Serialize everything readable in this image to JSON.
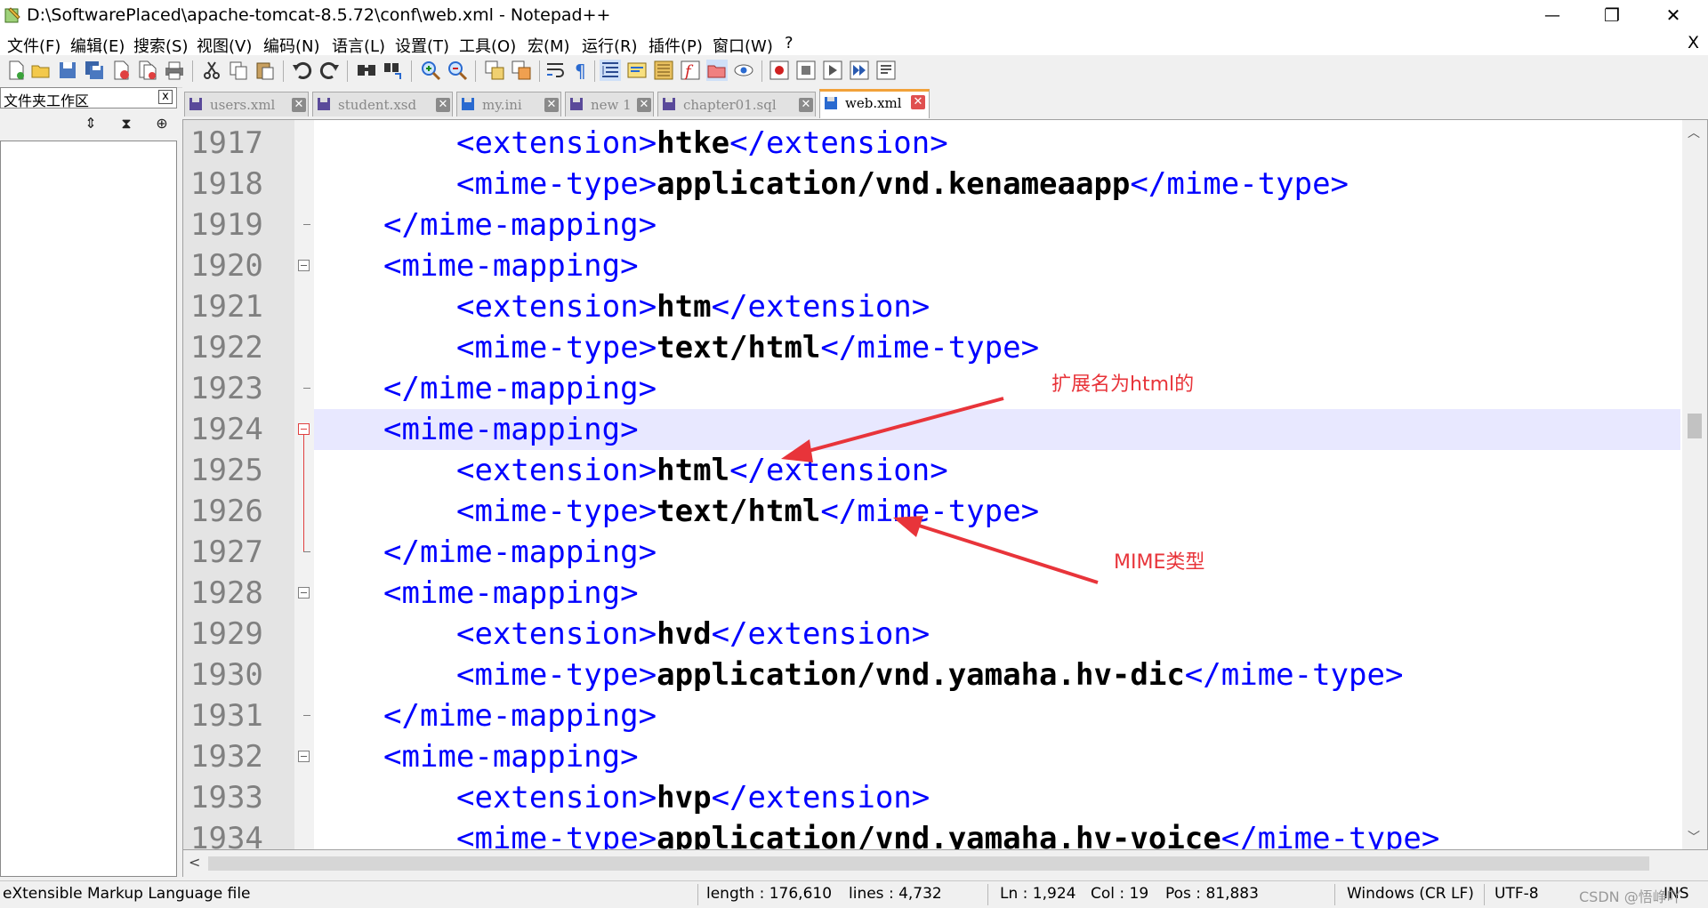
{
  "window": {
    "title": "D:\\SoftwarePlaced\\apache-tomcat-8.5.72\\conf\\web.xml - Notepad++",
    "minimize_glyph": "—",
    "maximize_glyph": "❐",
    "close_glyph": "✕"
  },
  "menu": {
    "items": [
      "文件(F)",
      "编辑(E)",
      "搜索(S)",
      "视图(V)",
      "编码(N)",
      "语言(L)",
      "设置(T)",
      "工具(O)",
      "宏(M)",
      "运行(R)",
      "插件(P)",
      "窗口(W)",
      "?"
    ],
    "close_glyph": "X"
  },
  "toolbar": {
    "buttons": [
      "new-file",
      "open-file",
      "save",
      "save-all",
      "close",
      "close-all",
      "print",
      "cut",
      "copy",
      "paste",
      "undo",
      "redo",
      "find",
      "replace",
      "zoom-in",
      "zoom-out",
      "sync-v",
      "sync-h",
      "word-wrap",
      "show-all-chars",
      "indent-guide",
      "user-language",
      "document-map",
      "function-list",
      "folder-workspace",
      "monitoring",
      "record-macro",
      "stop-macro",
      "play-macro",
      "run-macro-multiple",
      "save-macro"
    ]
  },
  "panel": {
    "title": "文件夹工作区",
    "close_glyph": "x",
    "tools": [
      "⇕",
      "⧗",
      "⊕"
    ]
  },
  "tabs": [
    {
      "label": "users.xml",
      "active": false
    },
    {
      "label": "student.xsd",
      "active": false
    },
    {
      "label": "my.ini",
      "active": false
    },
    {
      "label": "new 1",
      "active": false
    },
    {
      "label": "chapter01.sql",
      "active": false
    },
    {
      "label": "web.xml",
      "active": true
    }
  ],
  "tab_close_glyph": "✕",
  "editor": {
    "current_line": "1924",
    "lines": [
      {
        "n": "1917",
        "indent": 2,
        "tag_open": "<extension>",
        "value": "htke",
        "tag_close": "</extension>"
      },
      {
        "n": "1918",
        "indent": 2,
        "tag_open": "<mime-type>",
        "value": "application/vnd.kenameaapp",
        "tag_close": "</mime-type>"
      },
      {
        "n": "1919",
        "indent": 1,
        "tag_open": "</mime-mapping>",
        "value": "",
        "tag_close": ""
      },
      {
        "n": "1920",
        "indent": 1,
        "tag_open": "<mime-mapping>",
        "value": "",
        "tag_close": ""
      },
      {
        "n": "1921",
        "indent": 2,
        "tag_open": "<extension>",
        "value": "htm",
        "tag_close": "</extension>"
      },
      {
        "n": "1922",
        "indent": 2,
        "tag_open": "<mime-type>",
        "value": "text/html",
        "tag_close": "</mime-type>"
      },
      {
        "n": "1923",
        "indent": 1,
        "tag_open": "</mime-mapping>",
        "value": "",
        "tag_close": ""
      },
      {
        "n": "1924",
        "indent": 1,
        "tag_open": "<mime-mapping>",
        "value": "",
        "tag_close": ""
      },
      {
        "n": "1925",
        "indent": 2,
        "tag_open": "<extension>",
        "value": "html",
        "tag_close": "</extension>"
      },
      {
        "n": "1926",
        "indent": 2,
        "tag_open": "<mime-type>",
        "value": "text/html",
        "tag_close": "</mime-type>"
      },
      {
        "n": "1927",
        "indent": 1,
        "tag_open": "</mime-mapping>",
        "value": "",
        "tag_close": ""
      },
      {
        "n": "1928",
        "indent": 1,
        "tag_open": "<mime-mapping>",
        "value": "",
        "tag_close": ""
      },
      {
        "n": "1929",
        "indent": 2,
        "tag_open": "<extension>",
        "value": "hvd",
        "tag_close": "</extension>"
      },
      {
        "n": "1930",
        "indent": 2,
        "tag_open": "<mime-type>",
        "value": "application/vnd.yamaha.hv-dic",
        "tag_close": "</mime-type>"
      },
      {
        "n": "1931",
        "indent": 1,
        "tag_open": "</mime-mapping>",
        "value": "",
        "tag_close": ""
      },
      {
        "n": "1932",
        "indent": 1,
        "tag_open": "<mime-mapping>",
        "value": "",
        "tag_close": ""
      },
      {
        "n": "1933",
        "indent": 2,
        "tag_open": "<extension>",
        "value": "hvp",
        "tag_close": "</extension>"
      },
      {
        "n": "1934",
        "indent": 2,
        "tag_open": "<mime-type>",
        "value": "application/vnd.yamaha.hv-voice",
        "tag_close": "</mime-type>"
      }
    ]
  },
  "annotations": [
    {
      "text": "扩展名为html的",
      "color": "#e8343a"
    },
    {
      "text": "MIME类型",
      "color": "#e8343a"
    }
  ],
  "statusbar": {
    "file_type": "eXtensible Markup Language file",
    "length": "length : 176,610",
    "lines": "lines : 4,732",
    "ln": "Ln : 1,924",
    "col": "Col : 19",
    "pos": "Pos : 81,883",
    "eol": "Windows (CR LF)",
    "encoding": "UTF-8",
    "ins": "INS",
    "watermark": "CSDN @悟峥吖"
  },
  "colors": {
    "tag": "#0000ff",
    "value": "#000000",
    "current_line_bg": "#e8e8ff",
    "annotation": "#e8343a",
    "active_tab_accent": "#f2a23a"
  }
}
